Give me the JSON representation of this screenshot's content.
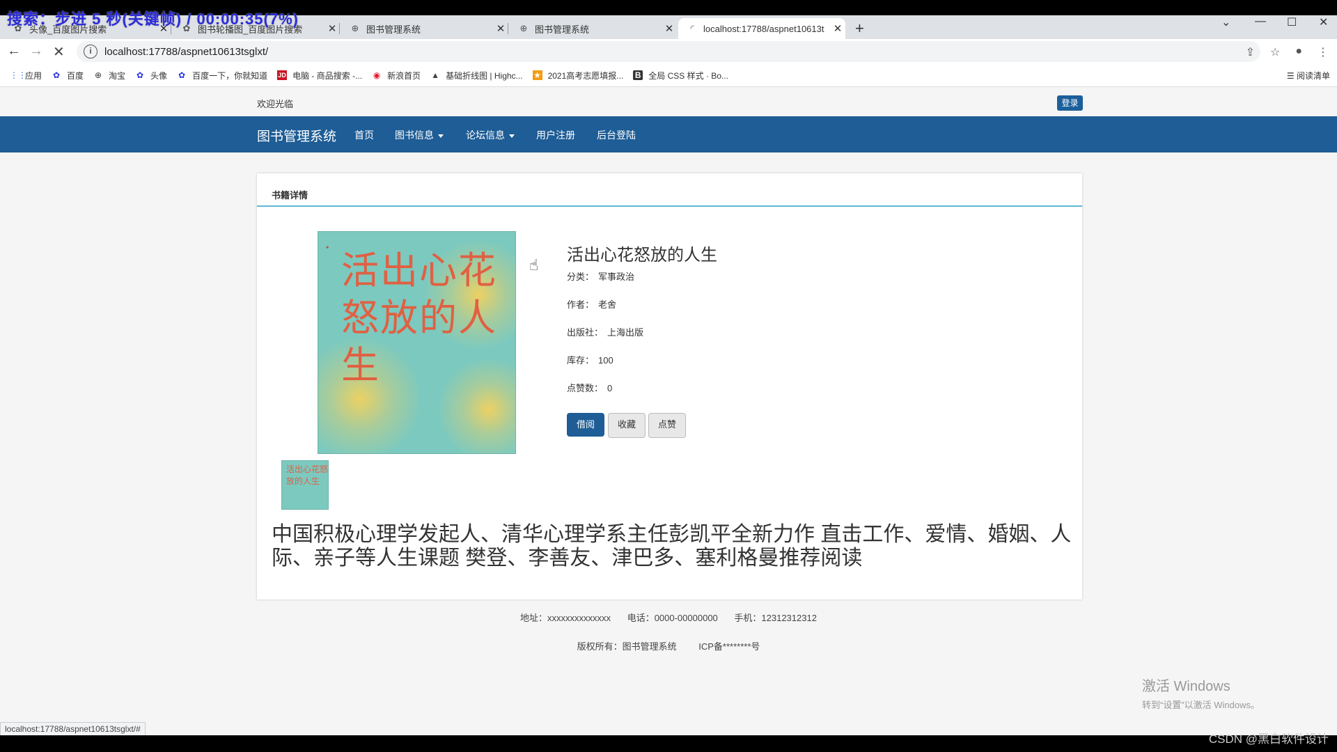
{
  "overlay": {
    "text": "搜索：步进 5 秒(关键帧) / 00:00:35(7%)"
  },
  "tabs": [
    {
      "title": "头像_百度图片搜索",
      "icon": "paw-icon"
    },
    {
      "title": "图书轮播图_百度图片搜索",
      "icon": "paw-icon"
    },
    {
      "title": "图书管理系统",
      "icon": "globe-icon"
    },
    {
      "title": "图书管理系统",
      "icon": "globe-icon"
    },
    {
      "title": "localhost:17788/aspnet10613t",
      "icon": "loading-icon",
      "active": true
    }
  ],
  "address": {
    "url": "localhost:17788/aspnet10613tsglxt/"
  },
  "bookmarks": [
    {
      "label": "应用",
      "icon": "apps-icon"
    },
    {
      "label": "百度",
      "icon": "paw-icon"
    },
    {
      "label": "淘宝",
      "icon": "globe-icon"
    },
    {
      "label": "头像",
      "icon": "paw-icon"
    },
    {
      "label": "百度一下，你就知道",
      "icon": "paw-icon"
    },
    {
      "label": "电脑 - 商品搜索 -...",
      "icon": "jd-icon"
    },
    {
      "label": "新浪首页",
      "icon": "weibo-icon"
    },
    {
      "label": "基础折线图 | Highc...",
      "icon": "highcharts-icon"
    },
    {
      "label": "2021高考志愿填报...",
      "icon": "orange-icon"
    },
    {
      "label": "全局 CSS 样式 · Bo...",
      "icon": "bootstrap-icon"
    }
  ],
  "reading_list": "阅读清单",
  "site": {
    "welcome": "欢迎光临",
    "login": "登录",
    "brand": "图书管理系统",
    "nav": [
      "首页",
      "图书信息",
      "论坛信息",
      "用户注册",
      "后台登陆"
    ]
  },
  "book": {
    "panel_title": "书籍详情",
    "cover_title": "活出心花怒放的人生",
    "title": "活出心花怒放的人生",
    "category_label": "分类：",
    "category": "军事政治",
    "author_label": "作者：",
    "author": "老舍",
    "publisher_label": "出版社：",
    "publisher": "上海出版",
    "stock_label": "库存：",
    "stock": "100",
    "likes_label": "点赞数：",
    "likes": "0",
    "buttons": {
      "borrow": "借阅",
      "favorite": "收藏",
      "like": "点赞"
    },
    "description": "中国积极心理学发起人、清华心理学系主任彭凯平全新力作 直击工作、爱情、婚姻、人际、亲子等人生课题 樊登、李善友、津巴多、塞利格曼推荐阅读"
  },
  "footer": {
    "address": "地址：xxxxxxxxxxxxxx",
    "phone": "电话：0000-00000000",
    "mobile": "手机：12312312312",
    "copyright": "版权所有：图书管理系统",
    "icp": "ICP备********号"
  },
  "watermark": {
    "line1": "激活 Windows",
    "line2": "转到“设置”以激活 Windows。"
  },
  "status_url": "localhost:17788/aspnet10613tsglxt/#",
  "credit": "CSDN @黑白软件设计"
}
